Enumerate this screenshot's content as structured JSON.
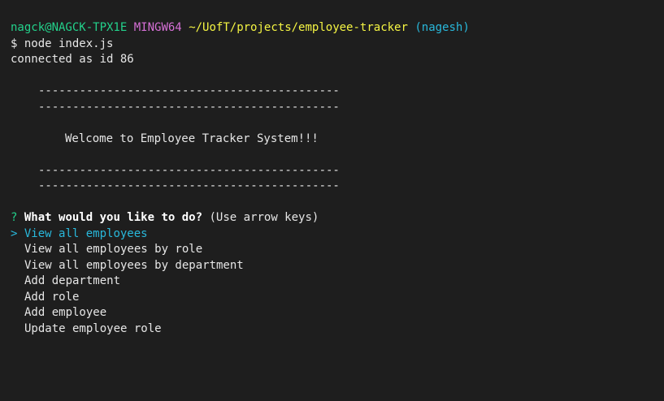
{
  "prompt": {
    "user_host": "nagck@NAGCK-TPX1E",
    "system": "MINGW64",
    "path": "~/UofT/projects/employee-tracker",
    "branch": "(nagesh)"
  },
  "command": "$ node index.js",
  "output": {
    "connected": "connected as id 86",
    "separator": "--------------------------------------------",
    "welcome": "Welcome to Employee Tracker System!!!"
  },
  "question": {
    "mark": "?",
    "text": "What would you like to do?",
    "hint": "(Use arrow keys)"
  },
  "menu": {
    "pointer": ">",
    "choices": [
      "View all employees",
      "View all employees by role",
      "View all employees by department",
      "Add department",
      "Add role",
      "Add employee",
      "Update employee role"
    ],
    "selected_index": 0
  },
  "colors": {
    "background": "#1e1e1e",
    "user_host": "#23d18b",
    "system": "#d670d6",
    "path": "#f5f543",
    "branch": "#29b8db",
    "selected": "#29b8db"
  }
}
